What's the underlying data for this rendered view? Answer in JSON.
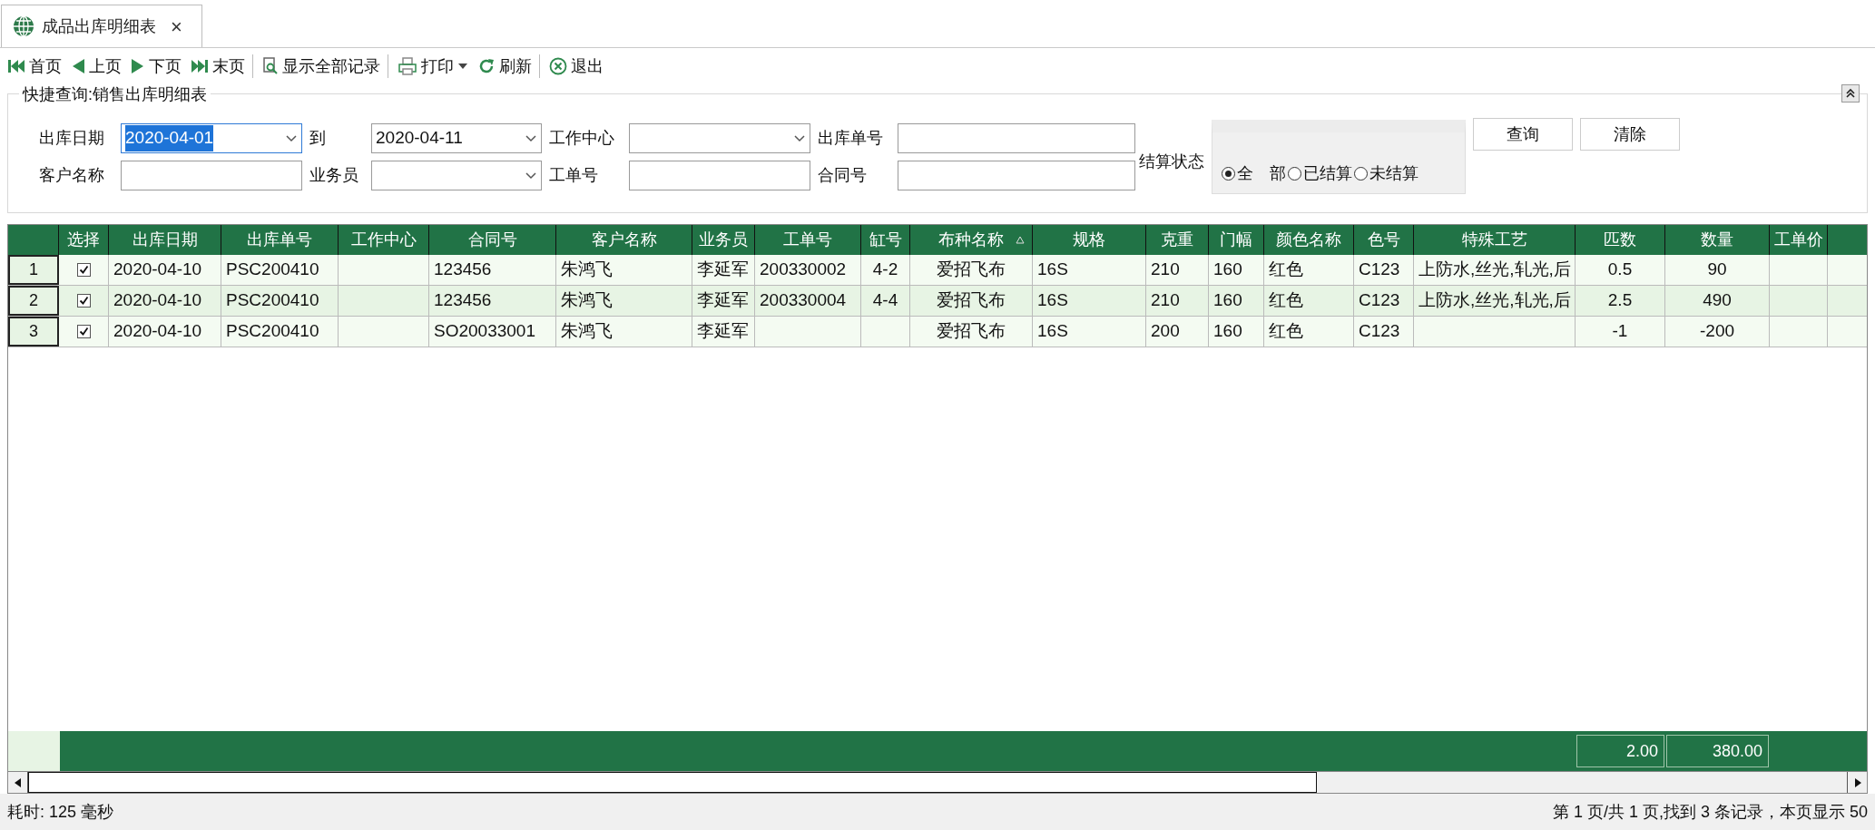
{
  "tab": {
    "title": "成品出库明细表",
    "close": "×"
  },
  "toolbar": [
    {
      "kind": "first",
      "label": "首页",
      "sep_before": false,
      "dropdown": false
    },
    {
      "kind": "prev",
      "label": "上页",
      "sep_before": false,
      "dropdown": false
    },
    {
      "kind": "next",
      "label": "下页",
      "sep_before": false,
      "dropdown": false
    },
    {
      "kind": "last",
      "label": "末页",
      "sep_before": false,
      "dropdown": false
    },
    {
      "kind": "showall",
      "label": "显示全部记录",
      "sep_before": true,
      "dropdown": false
    },
    {
      "kind": "print",
      "label": "打印",
      "sep_before": true,
      "dropdown": true
    },
    {
      "kind": "refresh",
      "label": "刷新",
      "sep_before": false,
      "dropdown": false
    },
    {
      "kind": "exit",
      "label": "退出",
      "sep_before": true,
      "dropdown": false
    }
  ],
  "query": {
    "title": "快捷查询:销售出库明细表",
    "rows": [
      [
        {
          "label": "出库日期",
          "kind": "combo",
          "value": "2020-04-01",
          "focused": true
        },
        {
          "label": "到",
          "kind": "combo",
          "value": "2020-04-11",
          "focused": false
        },
        {
          "label": "工作中心",
          "kind": "combo",
          "focused": false
        },
        {
          "label": "出库单号",
          "kind": "text",
          "focused": false
        }
      ],
      [
        {
          "label": "客户名称",
          "kind": "text",
          "focused": false
        },
        {
          "label": "业务员",
          "kind": "combo",
          "focused": false
        },
        {
          "label": "工单号",
          "kind": "text",
          "focused": false
        },
        {
          "label": "合同号",
          "kind": "text",
          "focused": false
        }
      ]
    ],
    "settle_label": "结算状态",
    "settle_options": [
      {
        "label": "全　部",
        "selected": true
      },
      {
        "label": "已结算",
        "selected": false
      },
      {
        "label": "未结算",
        "selected": false
      }
    ],
    "buttons": [
      "查询",
      "清除"
    ]
  },
  "table": {
    "select_column": "选择",
    "columns": [
      {
        "label": "出库日期",
        "sorted": false
      },
      {
        "label": "出库单号",
        "sorted": false
      },
      {
        "label": "工作中心",
        "sorted": false
      },
      {
        "label": "合同号",
        "sorted": false
      },
      {
        "label": "客户名称",
        "sorted": false
      },
      {
        "label": "业务员",
        "sorted": false
      },
      {
        "label": "工单号",
        "sorted": false
      },
      {
        "label": "缸号",
        "sorted": false
      },
      {
        "label": "布种名称",
        "sorted": true
      },
      {
        "label": "规格",
        "sorted": false
      },
      {
        "label": "克重",
        "sorted": false
      },
      {
        "label": "门幅",
        "sorted": false
      },
      {
        "label": "颜色名称",
        "sorted": false
      },
      {
        "label": "色号",
        "sorted": false
      },
      {
        "label": "特殊工艺",
        "sorted": false
      },
      {
        "label": "匹数",
        "sorted": false
      },
      {
        "label": "数量",
        "sorted": false
      },
      {
        "label": "工单价",
        "sorted": false
      }
    ],
    "rows": [
      {
        "number": "1",
        "checked": true,
        "cells": [
          "2020-04-10",
          "PSC200410",
          "",
          "123456",
          "朱鸿飞",
          "李延军",
          "200330002",
          "4-2",
          "爱招飞布",
          "16S",
          "210",
          "160",
          "红色",
          "C123",
          "上防水,丝光,轧光,后",
          "0.5",
          "90",
          ""
        ]
      },
      {
        "number": "2",
        "checked": true,
        "cells": [
          "2020-04-10",
          "PSC200410",
          "",
          "123456",
          "朱鸿飞",
          "李延军",
          "200330004",
          "4-4",
          "爱招飞布",
          "16S",
          "210",
          "160",
          "红色",
          "C123",
          "上防水,丝光,轧光,后",
          "2.5",
          "490",
          ""
        ]
      },
      {
        "number": "3",
        "checked": true,
        "cells": [
          "2020-04-10",
          "PSC200410",
          "",
          "SO20033001",
          "朱鸿飞",
          "李延军",
          "",
          "",
          "爱招飞布",
          "16S",
          "200",
          "160",
          "红色",
          "C123",
          "",
          "-1",
          "-200",
          ""
        ]
      }
    ],
    "totals": [
      "2.00",
      "380.00"
    ]
  },
  "status": {
    "left": "耗时: 125 毫秒",
    "right": "第 1 页/共 1 页,找到 3 条记录，本页显示 50"
  }
}
